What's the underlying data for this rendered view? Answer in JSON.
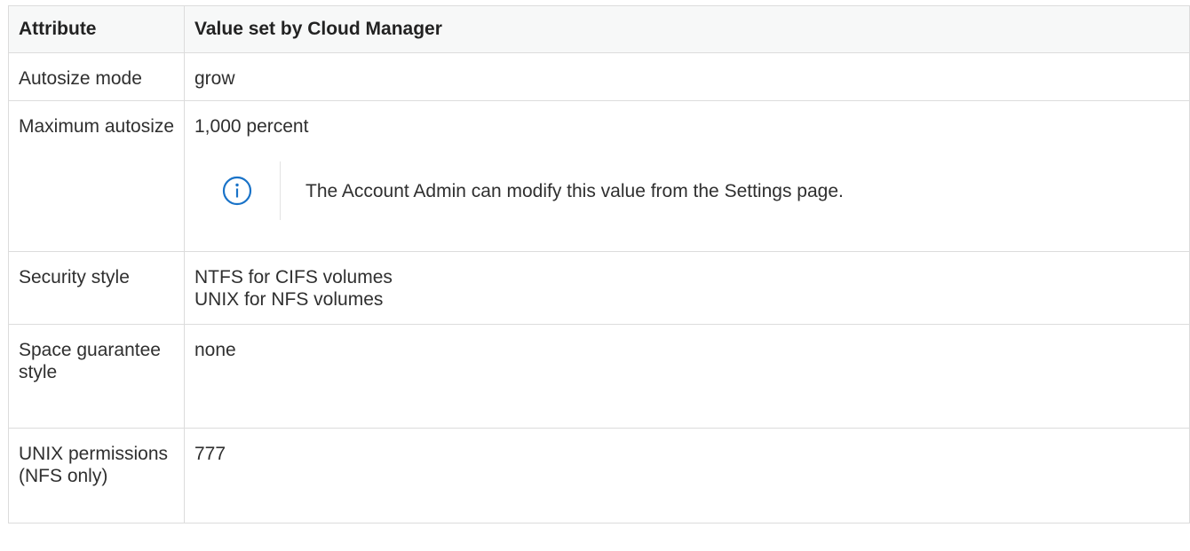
{
  "table": {
    "headers": [
      "Attribute",
      "Value set by Cloud Manager"
    ],
    "rows": [
      {
        "attribute": "Autosize mode",
        "value": "grow"
      },
      {
        "attribute": "Maximum autosize",
        "value": "1,000 percent",
        "note": {
          "icon": "info-icon",
          "text": "The Account Admin can modify this value from the Settings page."
        }
      },
      {
        "attribute": "Security style",
        "value_lines": [
          "NTFS for CIFS volumes",
          "UNIX for NFS volumes"
        ]
      },
      {
        "attribute": "Space guarantee style",
        "value": "none"
      },
      {
        "attribute": "UNIX permissions (NFS only)",
        "value": "777"
      }
    ]
  },
  "colors": {
    "border": "#dcdcdc",
    "header_bg": "#f7f8f8",
    "icon": "#1a73c8",
    "text": "#2f2f2f"
  }
}
